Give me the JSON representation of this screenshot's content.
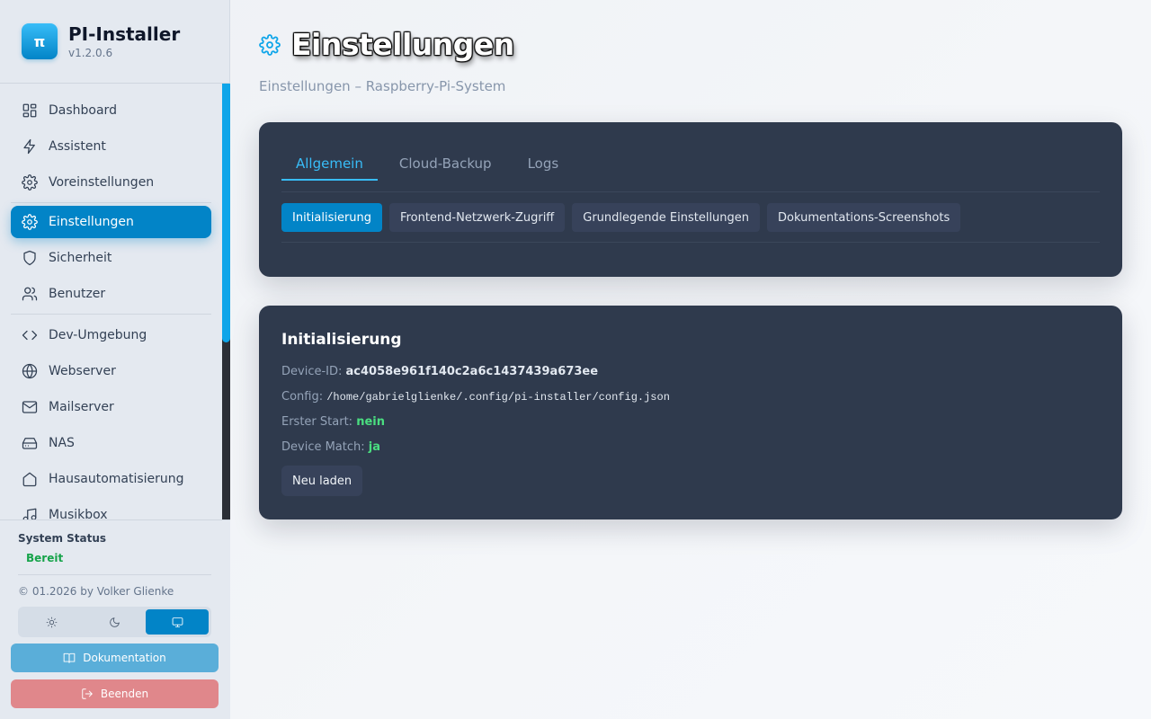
{
  "brand": {
    "title": "PI-Installer",
    "version": "v1.2.0.6",
    "logo_glyph": "π"
  },
  "sidebar": {
    "items": [
      {
        "label": "Dashboard",
        "icon": "dashboard-icon"
      },
      {
        "label": "Assistent",
        "icon": "lightning-icon"
      },
      {
        "label": "Voreinstellungen",
        "icon": "gear-icon"
      },
      {
        "label": "Einstellungen",
        "icon": "gear-icon",
        "active": true
      },
      {
        "label": "Sicherheit",
        "icon": "shield-icon"
      },
      {
        "label": "Benutzer",
        "icon": "users-icon"
      },
      {
        "label": "Dev-Umgebung",
        "icon": "code-icon"
      },
      {
        "label": "Webserver",
        "icon": "globe-icon"
      },
      {
        "label": "Mailserver",
        "icon": "mail-icon"
      },
      {
        "label": "NAS",
        "icon": "hard-drive-icon"
      },
      {
        "label": "Hausautomatisierung",
        "icon": "home-icon"
      },
      {
        "label": "Musikbox",
        "icon": "music-icon"
      }
    ]
  },
  "system_status": {
    "title": "System Status",
    "value": "Bereit",
    "color": "#16a34a"
  },
  "footer": {
    "copyright": "© 01.2026 by Volker Glienke",
    "theme_options": [
      "sun-icon",
      "moon-icon",
      "monitor-icon"
    ],
    "theme_selected": "monitor-icon",
    "docs_label": "Dokumentation",
    "quit_label": "Beenden"
  },
  "page": {
    "title": "Einstellungen",
    "subtitle": "Einstellungen – Raspberry-Pi-System"
  },
  "tabs": [
    {
      "label": "Allgemein",
      "active": true
    },
    {
      "label": "Cloud-Backup"
    },
    {
      "label": "Logs"
    }
  ],
  "subtabs": [
    {
      "label": "Initialisierung",
      "active": true
    },
    {
      "label": "Frontend-Netzwerk-Zugriff"
    },
    {
      "label": "Grundlegende Einstellungen"
    },
    {
      "label": "Dokumentations-Screenshots"
    }
  ],
  "init": {
    "title": "Initialisierung",
    "device_id_label": "Device-ID:",
    "device_id": "ac4058e961f140c2a6c1437439a673ee",
    "config_label": "Config:",
    "config": "/home/gabrielglienke/.config/pi-installer/config.json",
    "first_start_label": "Erster Start:",
    "first_start": "nein",
    "device_match_label": "Device Match:",
    "device_match": "ja",
    "reload_label": "Neu laden"
  },
  "colors": {
    "accent": "#0284c7",
    "card": "#2f3a4d",
    "ok": "#4ade80"
  }
}
